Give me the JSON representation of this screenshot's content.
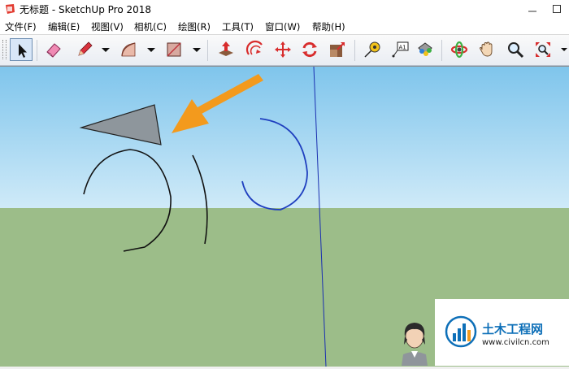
{
  "window": {
    "document_name": "无标题",
    "separator": " - ",
    "app_name": "SketchUp Pro 2018"
  },
  "menu": [
    {
      "label": "文件(F)"
    },
    {
      "label": "编辑(E)"
    },
    {
      "label": "视图(V)"
    },
    {
      "label": "相机(C)"
    },
    {
      "label": "绘图(R)"
    },
    {
      "label": "工具(T)"
    },
    {
      "label": "窗口(W)"
    },
    {
      "label": "帮助(H)"
    }
  ],
  "toolbar": {
    "tools": [
      {
        "icon": "select-arrow-icon",
        "active": true
      },
      {
        "icon": "eraser-icon"
      },
      {
        "icon": "pencil-icon"
      },
      {
        "icon": "arc-icon"
      },
      {
        "icon": "rectangle-icon"
      },
      {
        "icon": "push-pull-icon"
      },
      {
        "icon": "offset-icon"
      },
      {
        "icon": "move-icon"
      },
      {
        "icon": "rotate-icon"
      },
      {
        "icon": "scale-icon"
      },
      {
        "icon": "tape-measure-icon"
      },
      {
        "icon": "text-label-icon"
      },
      {
        "icon": "paint-bucket-icon"
      },
      {
        "icon": "orbit-icon"
      },
      {
        "icon": "pan-hand-icon"
      },
      {
        "icon": "zoom-icon"
      },
      {
        "icon": "zoom-extents-icon"
      }
    ]
  },
  "colors": {
    "sky": "#7fc5ec",
    "ground": "#9cbd89",
    "axis_blue": "#1a2fb0",
    "arrow_orange": "#f39a1d",
    "selected_arc": "#1f3fbf"
  },
  "watermark": {
    "brand": "土木工程网",
    "url": "www.civilcn.com"
  }
}
